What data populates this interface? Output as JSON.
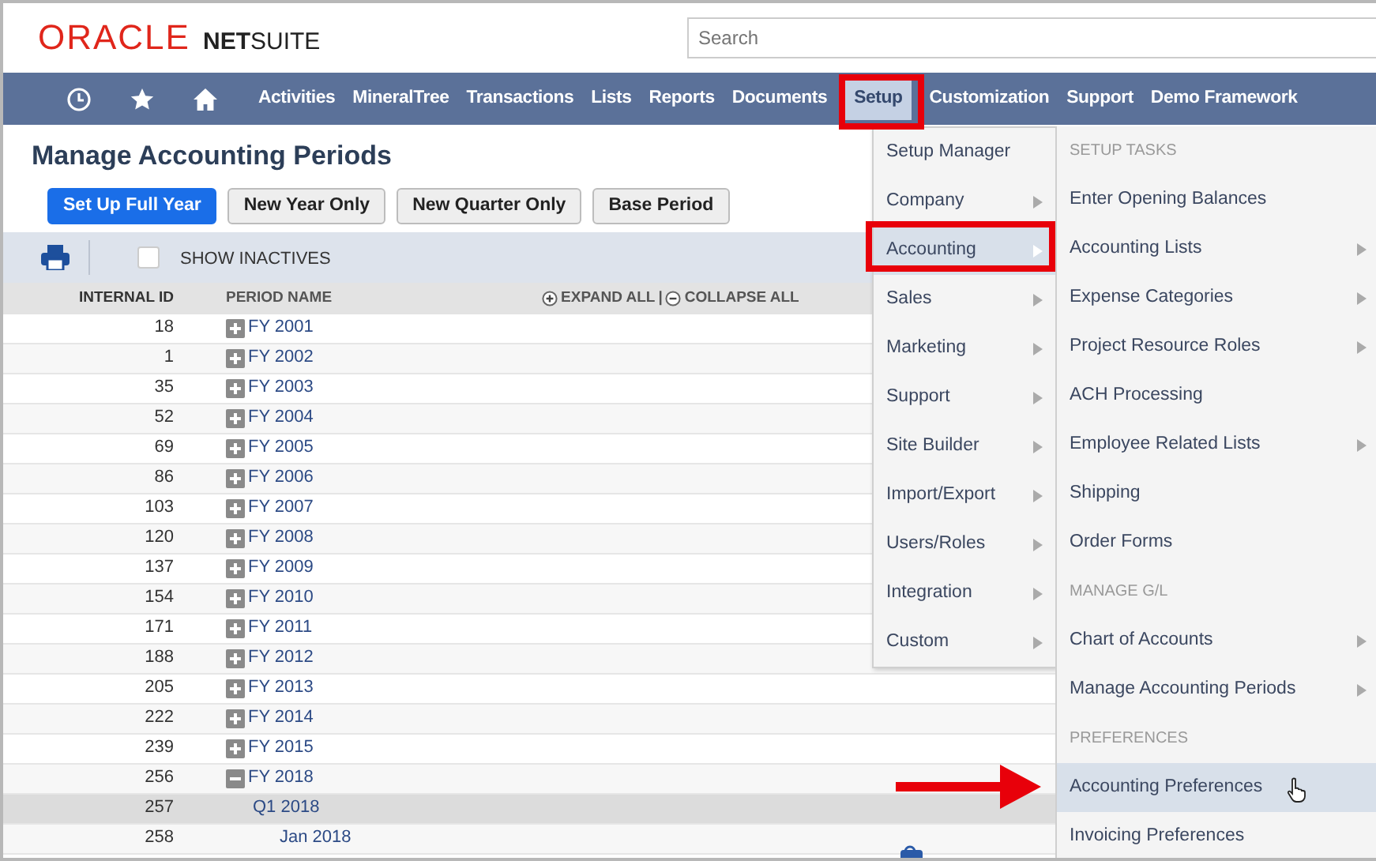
{
  "header": {
    "logo_brand": "ORACLE",
    "logo_product_bold": "NET",
    "logo_product": "SUITE",
    "search": {
      "placeholder": "Search"
    }
  },
  "nav": {
    "icons": [
      {
        "kind": "recent"
      },
      {
        "kind": "star"
      },
      {
        "kind": "home"
      }
    ],
    "items": [
      {
        "label": "Activities",
        "selected": false
      },
      {
        "label": "MineralTree",
        "selected": false
      },
      {
        "label": "Transactions",
        "selected": false
      },
      {
        "label": "Lists",
        "selected": false
      },
      {
        "label": "Reports",
        "selected": false
      },
      {
        "label": "Documents",
        "selected": false
      },
      {
        "label": "Setup",
        "selected": true
      },
      {
        "label": "Customization",
        "selected": false
      },
      {
        "label": "Support",
        "selected": false
      },
      {
        "label": "Demo Framework",
        "selected": false
      }
    ]
  },
  "page": {
    "title": "Manage Accounting Periods",
    "buttons": [
      {
        "label": "Set Up Full Year",
        "primary": true
      },
      {
        "label": "New Year Only",
        "primary": false
      },
      {
        "label": "New Quarter Only",
        "primary": false
      },
      {
        "label": "Base Period",
        "primary": false
      }
    ],
    "show_inactives": {
      "label": "SHOW INACTIVES",
      "checked": false
    }
  },
  "table": {
    "columns": [
      "INTERNAL ID",
      "PERIOD NAME"
    ],
    "expand_all": "EXPAND ALL",
    "separator": "|",
    "collapse_all": "COLLAPSE ALL",
    "rows": [
      {
        "id": "18",
        "name": "FY 2001",
        "expanded": false,
        "selected": false
      },
      {
        "id": "1",
        "name": "FY 2002",
        "expanded": false,
        "selected": false
      },
      {
        "id": "35",
        "name": "FY 2003",
        "expanded": false,
        "selected": false
      },
      {
        "id": "52",
        "name": "FY 2004",
        "expanded": false,
        "selected": false
      },
      {
        "id": "69",
        "name": "FY 2005",
        "expanded": false,
        "selected": false
      },
      {
        "id": "86",
        "name": "FY 2006",
        "expanded": false,
        "selected": false
      },
      {
        "id": "103",
        "name": "FY 2007",
        "expanded": false,
        "selected": false
      },
      {
        "id": "120",
        "name": "FY 2008",
        "expanded": false,
        "selected": false
      },
      {
        "id": "137",
        "name": "FY 2009",
        "expanded": false,
        "selected": false
      },
      {
        "id": "154",
        "name": "FY 2010",
        "expanded": false,
        "selected": false
      },
      {
        "id": "171",
        "name": "FY 2011",
        "expanded": false,
        "selected": false
      },
      {
        "id": "188",
        "name": "FY 2012",
        "expanded": false,
        "selected": false
      },
      {
        "id": "205",
        "name": "FY 2013",
        "expanded": false,
        "selected": false
      },
      {
        "id": "222",
        "name": "FY 2014",
        "expanded": false,
        "selected": false
      },
      {
        "id": "239",
        "name": "FY 2015",
        "expanded": false,
        "selected": false
      },
      {
        "id": "256",
        "name": "FY 2018",
        "expanded": true,
        "selected": false,
        "children": [
          {
            "id": "257",
            "name": "Q1 2018",
            "selected": true,
            "children": [
              {
                "id": "258",
                "name": "Jan 2018",
                "selected": false
              }
            ]
          }
        ]
      }
    ]
  },
  "setup_menu": {
    "items": [
      {
        "label": "Setup Manager",
        "submenu": false,
        "selected": false
      },
      {
        "label": "Company",
        "submenu": true,
        "selected": false
      },
      {
        "label": "Accounting",
        "submenu": true,
        "selected": true
      },
      {
        "label": "Sales",
        "submenu": true,
        "selected": false
      },
      {
        "label": "Marketing",
        "submenu": true,
        "selected": false
      },
      {
        "label": "Support",
        "submenu": true,
        "selected": false
      },
      {
        "label": "Site Builder",
        "submenu": true,
        "selected": false
      },
      {
        "label": "Import/Export",
        "submenu": true,
        "selected": false
      },
      {
        "label": "Users/Roles",
        "submenu": true,
        "selected": false
      },
      {
        "label": "Integration",
        "submenu": true,
        "selected": false
      },
      {
        "label": "Custom",
        "submenu": true,
        "selected": false
      }
    ]
  },
  "accounting_menu": {
    "items": [
      {
        "kind": "heading",
        "label": "SETUP TASKS"
      },
      {
        "kind": "item",
        "label": "Enter Opening Balances",
        "submenu": false,
        "selected": false
      },
      {
        "kind": "item",
        "label": "Accounting Lists",
        "submenu": true,
        "selected": false
      },
      {
        "kind": "item",
        "label": "Expense Categories",
        "submenu": true,
        "selected": false
      },
      {
        "kind": "item",
        "label": "Project Resource Roles",
        "submenu": true,
        "selected": false
      },
      {
        "kind": "item",
        "label": "ACH Processing",
        "submenu": false,
        "selected": false
      },
      {
        "kind": "item",
        "label": "Employee Related Lists",
        "submenu": true,
        "selected": false
      },
      {
        "kind": "item",
        "label": "Shipping",
        "submenu": false,
        "selected": false
      },
      {
        "kind": "item",
        "label": "Order Forms",
        "submenu": false,
        "selected": false
      },
      {
        "kind": "heading",
        "label": "MANAGE G/L"
      },
      {
        "kind": "item",
        "label": "Chart of Accounts",
        "submenu": true,
        "selected": false
      },
      {
        "kind": "item",
        "label": "Manage Accounting Periods",
        "submenu": true,
        "selected": false
      },
      {
        "kind": "heading",
        "label": "PREFERENCES"
      },
      {
        "kind": "item",
        "label": "Accounting Preferences",
        "submenu": false,
        "selected": true
      },
      {
        "kind": "item",
        "label": "Invoicing Preferences",
        "submenu": false,
        "selected": false
      }
    ]
  }
}
